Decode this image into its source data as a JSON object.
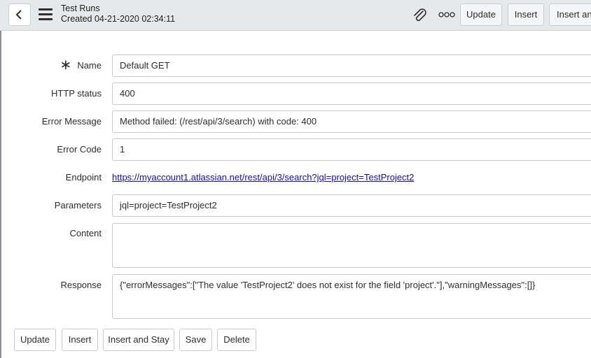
{
  "header": {
    "title": "Test Runs",
    "subtitle": "Created 04-21-2020 02:34:11",
    "icons": [
      "chevron-left-icon",
      "hamburger-menu-icon",
      "paperclip-icon",
      "more-options-icon"
    ],
    "buttons": {
      "update": "Update",
      "insert": "Insert",
      "insert_and_stay": "Insert and Stay"
    }
  },
  "form": {
    "required_marker": "∗",
    "name": {
      "label": "Name",
      "value": "Default GET"
    },
    "http_status": {
      "label": "HTTP status",
      "value": "400"
    },
    "error_message": {
      "label": "Error Message",
      "value": "Method failed: (/rest/api/3/search) with code: 400"
    },
    "error_code": {
      "label": "Error Code",
      "value": "1"
    },
    "endpoint": {
      "label": "Endpoint",
      "value": "https://myaccount1.atlassian.net/rest/api/3/search?jql=project=TestProject2"
    },
    "parameters": {
      "label": "Parameters",
      "value": "jql=project=TestProject2"
    },
    "content": {
      "label": "Content",
      "value": ""
    },
    "response": {
      "label": "Response",
      "value": "{\"errorMessages\":[\"The value 'TestProject2' does not exist for the field 'project'.\"],\"warningMessages\":[]}"
    }
  },
  "footer": {
    "update": "Update",
    "insert": "Insert",
    "insert_and_stay": "Insert and Stay",
    "save": "Save",
    "delete": "Delete"
  }
}
